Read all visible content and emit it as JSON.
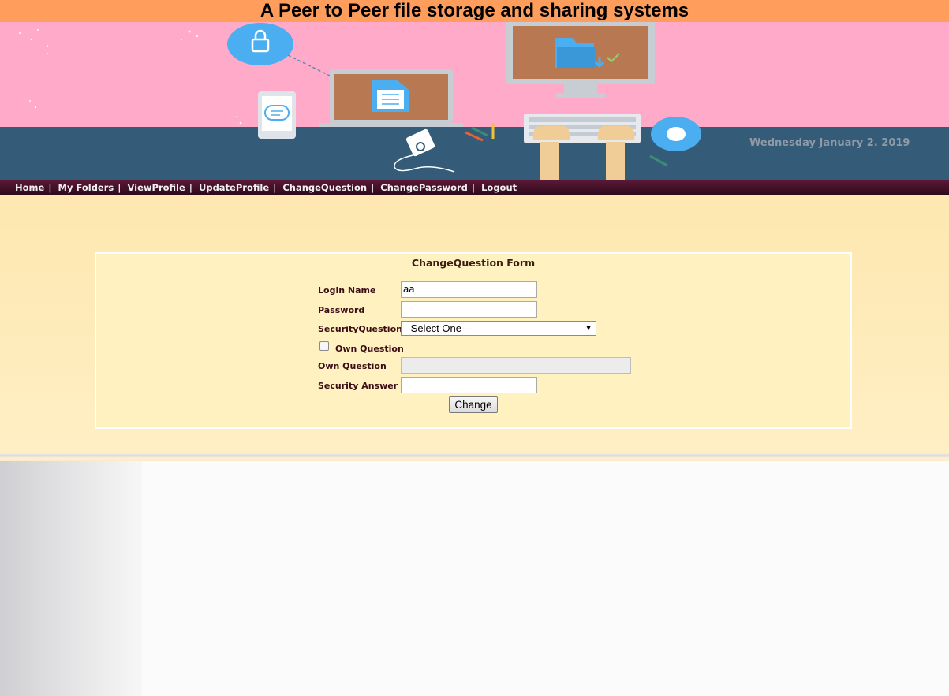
{
  "header": {
    "title": "A Peer to Peer file storage and sharing systems",
    "date": "Wednesday January 2. 2019"
  },
  "nav": {
    "items": [
      {
        "label": "Home"
      },
      {
        "label": "My Folders"
      },
      {
        "label": "ViewProfile"
      },
      {
        "label": "UpdateProfile"
      },
      {
        "label": "ChangeQuestion"
      },
      {
        "label": "ChangePassword"
      },
      {
        "label": "Logout"
      }
    ],
    "separator": "|"
  },
  "form": {
    "title": "ChangeQuestion Form",
    "login_name_label": "Login Name",
    "login_name_value": "aa",
    "password_label": "Password",
    "password_value": "",
    "security_question_label": "SecurityQuestion",
    "security_question_selected": "--Select One---",
    "own_question_checkbox_label": "Own Question",
    "own_question_label": "Own Question",
    "own_question_value": "",
    "security_answer_label": "Security Answer",
    "security_answer_value": "",
    "submit_label": "Change"
  },
  "colors": {
    "title_bar": "#ff9d5c",
    "banner_sky": "#ffaac9",
    "banner_desk": "#345c78",
    "nav_bar": "#4a1230",
    "content_bg": "#fee7b0",
    "form_bg": "#fff1c0"
  },
  "icons": [
    "lock-icon",
    "document-icon",
    "folder-icon",
    "chat-icon",
    "mouse-icon",
    "music-player-icon",
    "keyboard-icon"
  ]
}
